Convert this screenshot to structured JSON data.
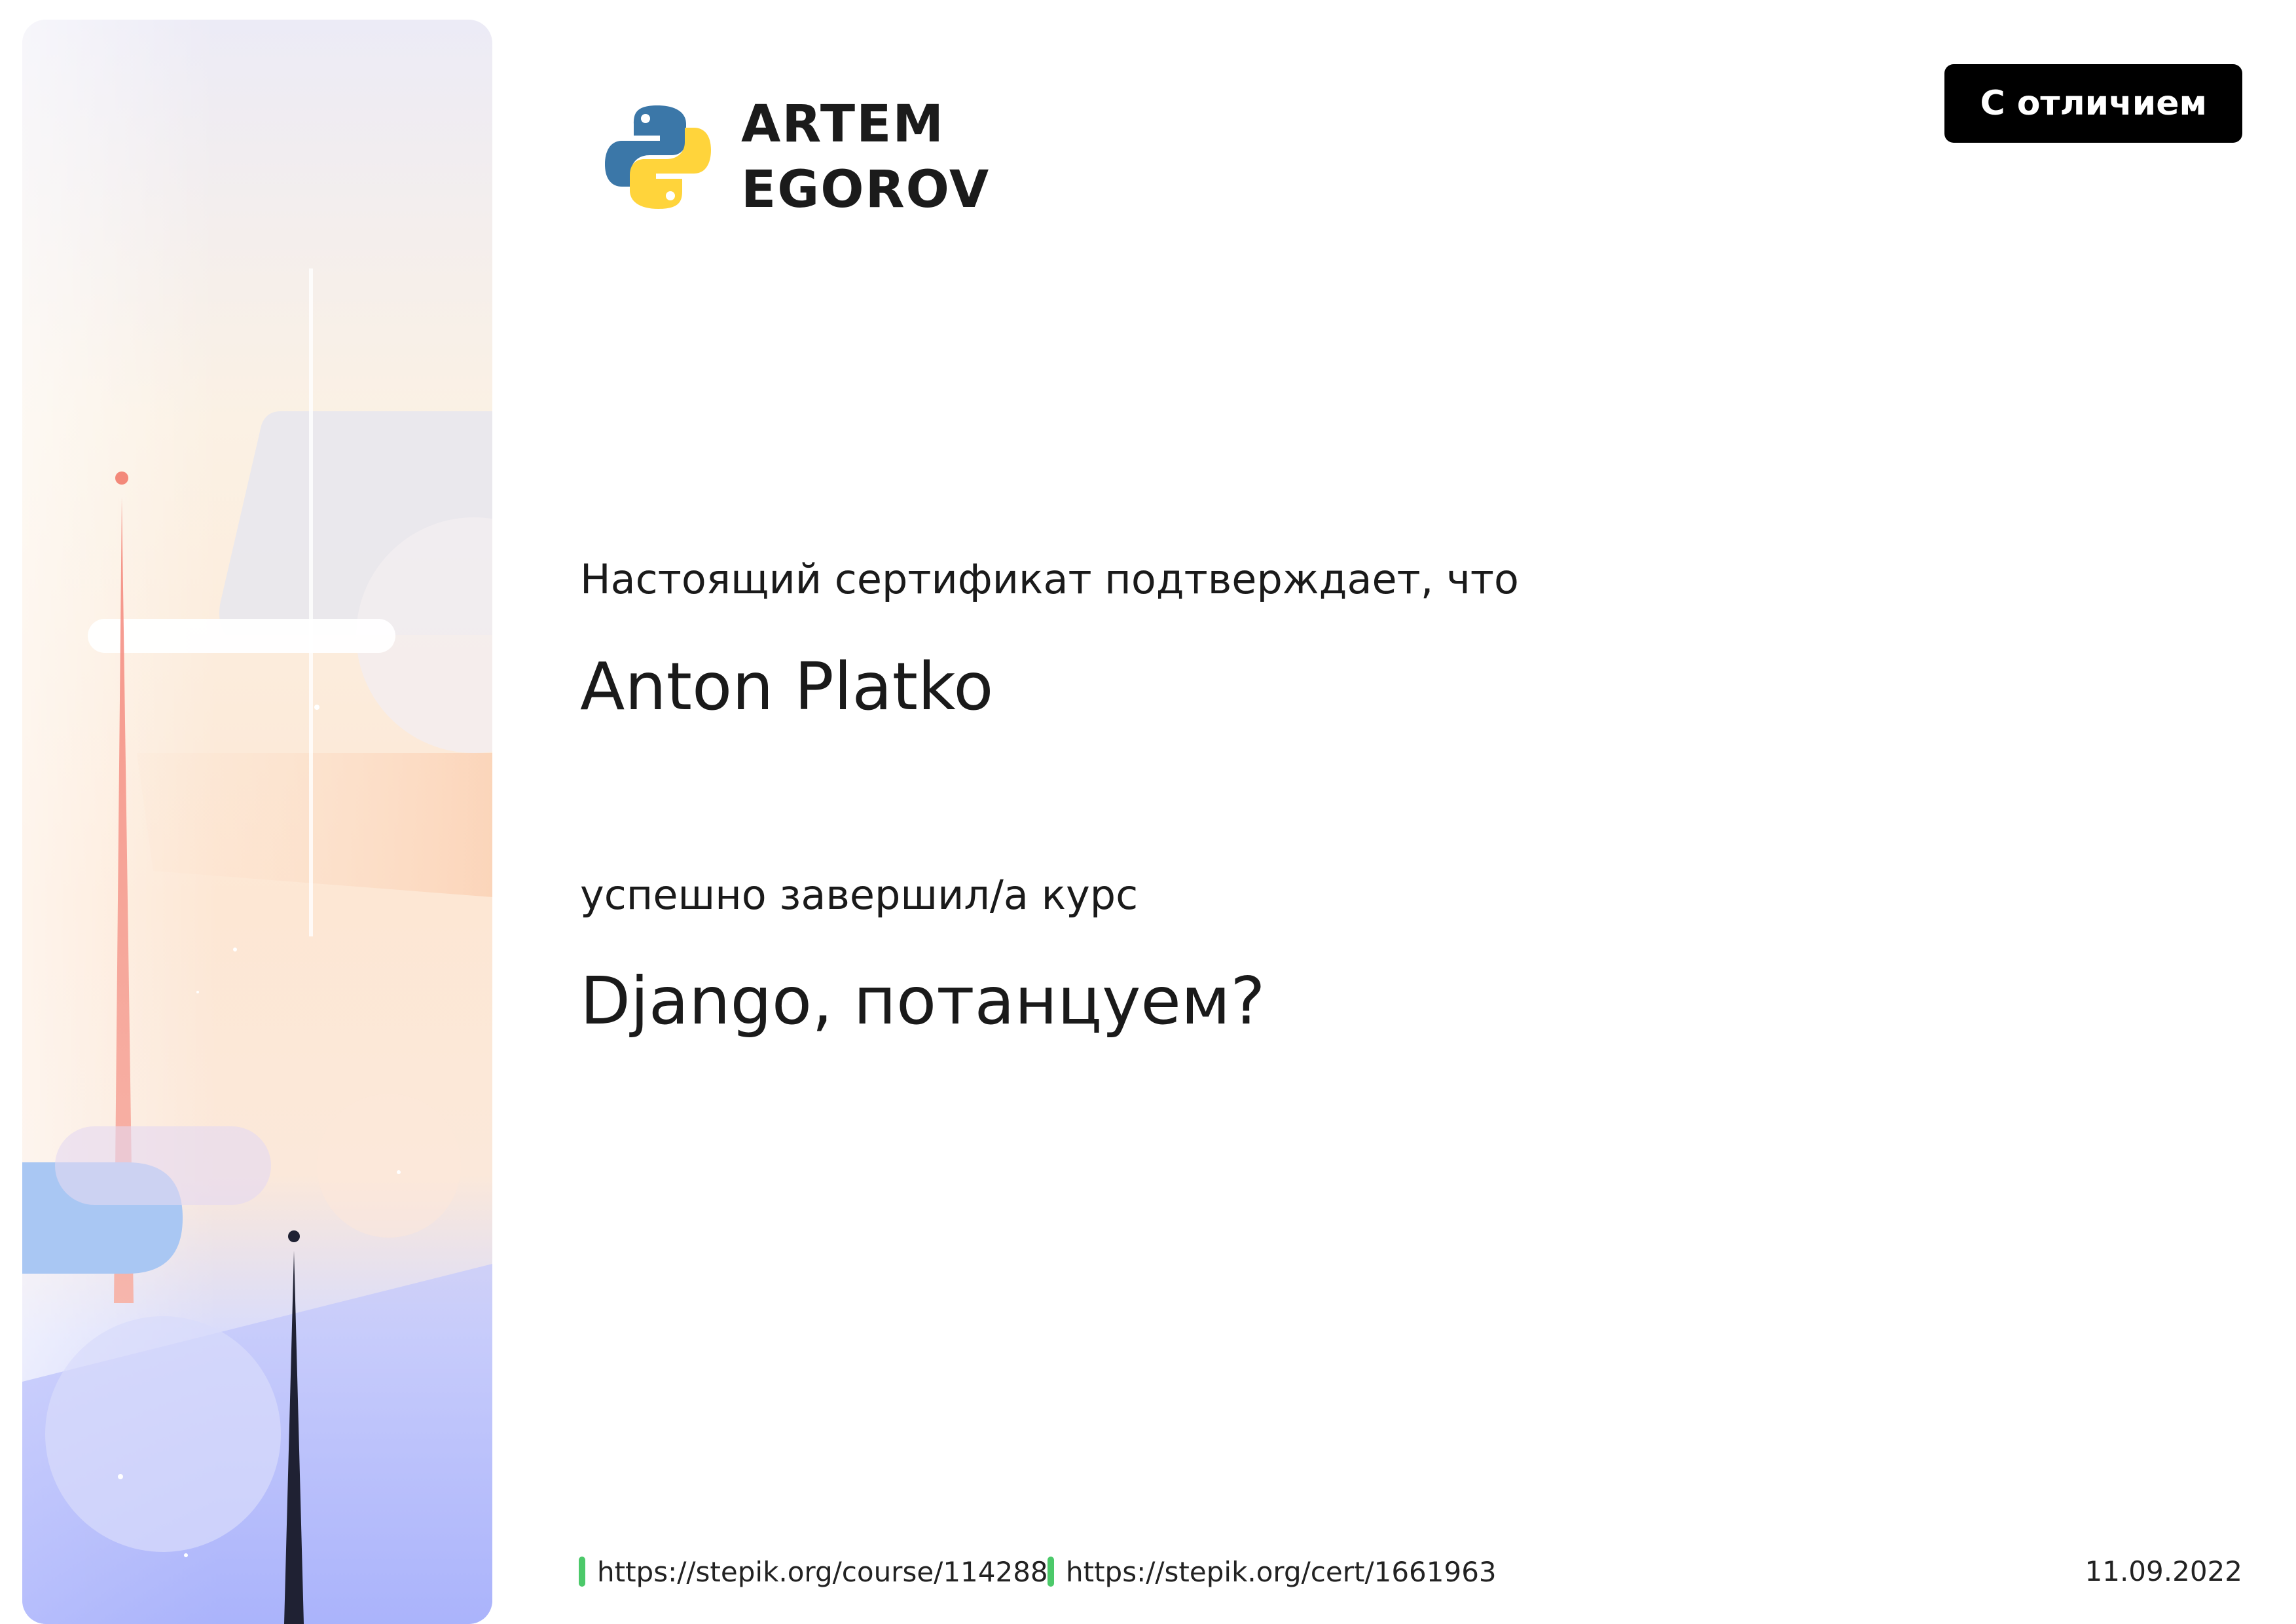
{
  "author": {
    "name_line1": "ARTEM",
    "name_line2": "EGOROV",
    "logo_icon": "python-logo-icon"
  },
  "badge": {
    "label": "С отличием"
  },
  "certificate": {
    "intro": "Настоящий сертификат подтверждает, что",
    "recipient": "Anton Platko",
    "completed_text": "успешно завершил/а  курс",
    "course_title": "Django, потанцуем?"
  },
  "footer": {
    "course_url": "https://stepik.org/course/114288",
    "cert_url": "https://stepik.org/cert/1661963",
    "date": "11.09.2022",
    "link_marker_color": "#4cc96a"
  },
  "colors": {
    "badge_bg": "#000000",
    "badge_text": "#ffffff",
    "python_blue": "#3b77a8",
    "python_yellow": "#ffd43b"
  }
}
